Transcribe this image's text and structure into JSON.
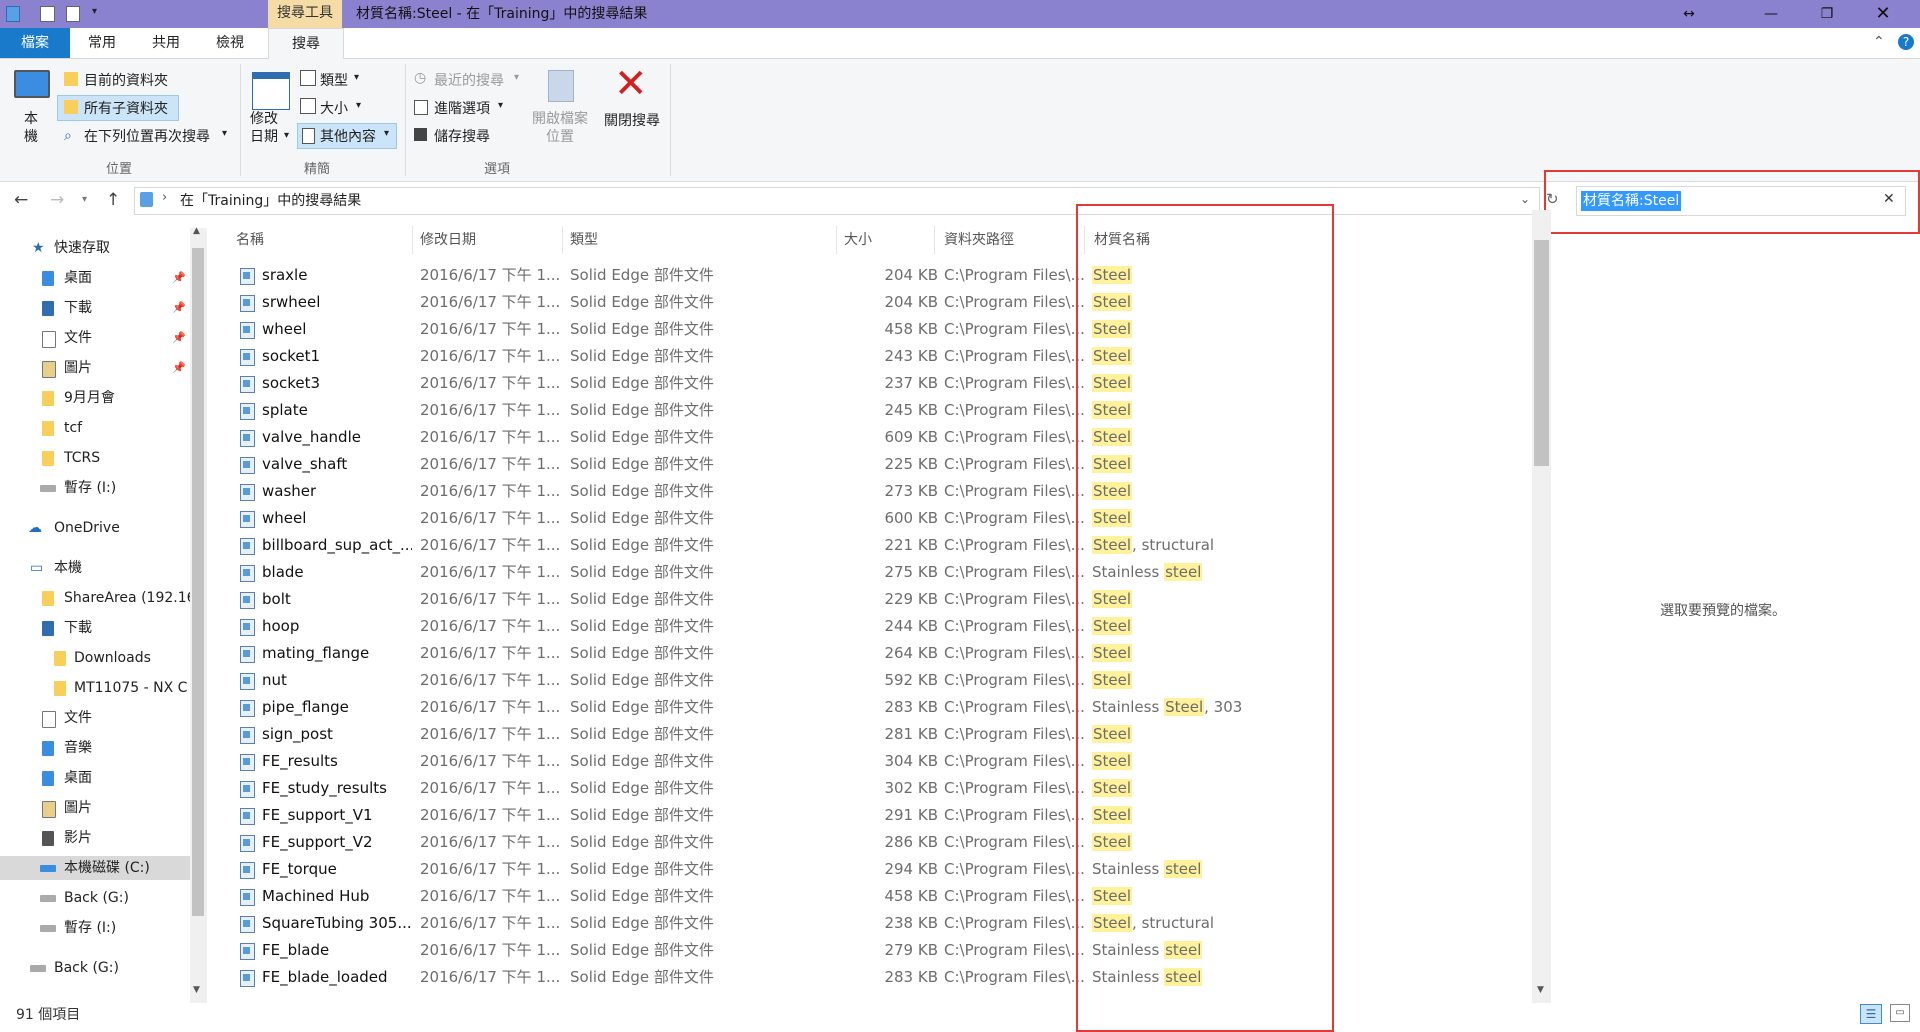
{
  "window": {
    "context_tab": "搜尋工具",
    "title": "材質名稱:Steel - 在「Training」中的搜尋結果"
  },
  "ribbon_tabs": [
    "檔案",
    "常用",
    "共用",
    "檢視",
    "搜尋"
  ],
  "ribbon": {
    "this_pc": "本\n機",
    "location": {
      "current_folder": "目前的資料夾",
      "all_subfolders": "所有子資料夾",
      "search_again": "在下列位置再次搜尋",
      "group": "位置"
    },
    "refine": {
      "date_modified": "修改\n日期",
      "kind": "類型",
      "size": "大小",
      "other_props": "其他內容",
      "group": "精簡"
    },
    "options": {
      "recent_searches": "最近的搜尋",
      "advanced": "進階選項",
      "save_search": "儲存搜尋",
      "open_location": "開啟檔案\n位置",
      "group": "選項"
    },
    "close_search": "關閉搜尋"
  },
  "address": {
    "path": "在「Training」中的搜尋結果",
    "search_query": "材質名稱:Steel"
  },
  "nav": {
    "quick_access": "快速存取",
    "items": [
      {
        "label": "桌面",
        "pinned": true
      },
      {
        "label": "下載",
        "pinned": true
      },
      {
        "label": "文件",
        "pinned": true
      },
      {
        "label": "圖片",
        "pinned": true
      },
      {
        "label": "9月月會",
        "pinned": false
      },
      {
        "label": "tcf",
        "pinned": false
      },
      {
        "label": "TCRS",
        "pinned": false
      },
      {
        "label": "暫存 (I:)",
        "pinned": false
      }
    ],
    "onedrive": "OneDrive",
    "this_pc": "本機",
    "pc_items": [
      "ShareArea (192.16",
      "下載",
      "Downloads",
      "MT11075 - NX C",
      "文件",
      "音樂",
      "桌面",
      "圖片",
      "影片",
      "本機磁碟 (C:)",
      "Back (G:)",
      "暫存 (I:)"
    ],
    "network": "Back (G:)"
  },
  "columns": {
    "name": "名稱",
    "date": "修改日期",
    "type": "類型",
    "size": "大小",
    "path": "資料夾路徑",
    "material": "材質名稱"
  },
  "file_date": "2016/6/17 下午 1...",
  "file_type": "Solid Edge 部件文件",
  "file_path": "C:\\Program Files\\...",
  "files": [
    {
      "name": "sraxle",
      "size": "204 KB",
      "pre": "",
      "hl": "Steel",
      "post": ""
    },
    {
      "name": "srwheel",
      "size": "204 KB",
      "pre": "",
      "hl": "Steel",
      "post": ""
    },
    {
      "name": "wheel",
      "size": "458 KB",
      "pre": "",
      "hl": "Steel",
      "post": ""
    },
    {
      "name": "socket1",
      "size": "243 KB",
      "pre": "",
      "hl": "Steel",
      "post": ""
    },
    {
      "name": "socket3",
      "size": "237 KB",
      "pre": "",
      "hl": "Steel",
      "post": ""
    },
    {
      "name": "splate",
      "size": "245 KB",
      "pre": "",
      "hl": "Steel",
      "post": ""
    },
    {
      "name": "valve_handle",
      "size": "609 KB",
      "pre": "",
      "hl": "Steel",
      "post": ""
    },
    {
      "name": "valve_shaft",
      "size": "225 KB",
      "pre": "",
      "hl": "Steel",
      "post": ""
    },
    {
      "name": "washer",
      "size": "273 KB",
      "pre": "",
      "hl": "Steel",
      "post": ""
    },
    {
      "name": "wheel",
      "size": "600 KB",
      "pre": "",
      "hl": "Steel",
      "post": ""
    },
    {
      "name": "billboard_sup_act_...",
      "size": "221 KB",
      "pre": "",
      "hl": "Steel",
      "post": ", structural"
    },
    {
      "name": "blade",
      "size": "275 KB",
      "pre": "Stainless ",
      "hl": "steel",
      "post": ""
    },
    {
      "name": "bolt",
      "size": "229 KB",
      "pre": "",
      "hl": "Steel",
      "post": ""
    },
    {
      "name": "hoop",
      "size": "244 KB",
      "pre": "",
      "hl": "Steel",
      "post": ""
    },
    {
      "name": "mating_flange",
      "size": "264 KB",
      "pre": "",
      "hl": "Steel",
      "post": ""
    },
    {
      "name": "nut",
      "size": "592 KB",
      "pre": "",
      "hl": "Steel",
      "post": ""
    },
    {
      "name": "pipe_flange",
      "size": "283 KB",
      "pre": "Stainless ",
      "hl": "Steel",
      "post": ", 303"
    },
    {
      "name": "sign_post",
      "size": "281 KB",
      "pre": "",
      "hl": "Steel",
      "post": ""
    },
    {
      "name": "FE_results",
      "size": "304 KB",
      "pre": "",
      "hl": "Steel",
      "post": ""
    },
    {
      "name": "FE_study_results",
      "size": "302 KB",
      "pre": "",
      "hl": "Steel",
      "post": ""
    },
    {
      "name": "FE_support_V1",
      "size": "291 KB",
      "pre": "",
      "hl": "Steel",
      "post": ""
    },
    {
      "name": "FE_support_V2",
      "size": "286 KB",
      "pre": "",
      "hl": "Steel",
      "post": ""
    },
    {
      "name": "FE_torque",
      "size": "294 KB",
      "pre": "Stainless ",
      "hl": "steel",
      "post": ""
    },
    {
      "name": "Machined Hub",
      "size": "458 KB",
      "pre": "",
      "hl": "Steel",
      "post": ""
    },
    {
      "name": "SquareTubing 305...",
      "size": "238 KB",
      "pre": "",
      "hl": "Steel",
      "post": ", structural"
    },
    {
      "name": "FE_blade",
      "size": "279 KB",
      "pre": "Stainless ",
      "hl": "steel",
      "post": ""
    },
    {
      "name": "FE_blade_loaded",
      "size": "283 KB",
      "pre": "Stainless ",
      "hl": "steel",
      "post": ""
    }
  ],
  "preview_message": "選取要預覽的檔案。",
  "status": "91 個項目",
  "colors": {
    "title_bar": "#8a82cf",
    "context_tab": "#f5dca6",
    "file_tab": "#1979ca",
    "highlight": "#fff29a",
    "annotation_box": "#e53935"
  }
}
